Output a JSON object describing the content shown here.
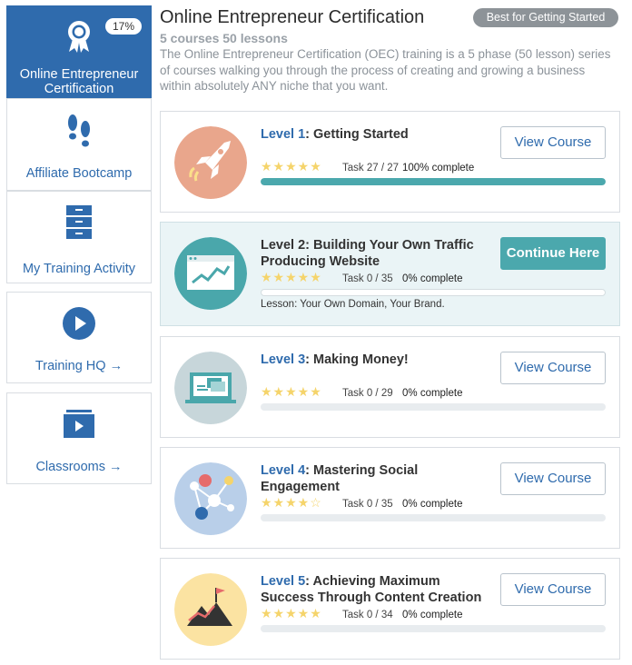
{
  "sidebar": {
    "items": [
      {
        "label": "Online Entrepreneur Certification",
        "badge": "17%",
        "icon": "award-ribbon-icon"
      },
      {
        "label": "Affiliate Bootcamp",
        "icon": "footprints-icon"
      },
      {
        "label": "My Training Activity",
        "icon": "file-cabinet-icon"
      },
      {
        "label": "Training HQ →",
        "icon": "play-circle-icon"
      },
      {
        "label": "Classrooms →",
        "icon": "video-folder-icon"
      }
    ]
  },
  "header": {
    "title": "Online Entrepreneur Certification",
    "subtitle": "5 courses 50 lessons",
    "description": "The Online Entrepreneur Certification (OEC) training is a 5 phase (50 lesson) series of courses walking you through the process of creating and growing a business within absolutely ANY niche that you want.",
    "badge": "Best for Getting Started"
  },
  "courses": [
    {
      "level": "Level 1",
      "title": ": Getting Started",
      "task": "Task 27 / 27",
      "complete": "100% complete",
      "progress": 1.0,
      "button": "View Course",
      "rating": "5 stars",
      "icon": "rocket-icon",
      "color": "#e9a68c"
    },
    {
      "level": "Level 2",
      "title": ": Building Your Own Traffic Producing Website",
      "task": "Task 0 / 35",
      "complete": "0% complete",
      "progress": 0,
      "button": "Continue Here",
      "rating": "5 stars",
      "lesson": "Lesson: Your Own Domain, Your Brand.",
      "icon": "website-chart-icon",
      "color": "#4aa7ab"
    },
    {
      "level": "Level 3",
      "title": ": Making Money!",
      "task": "Task 0 / 29",
      "complete": "0% complete",
      "progress": 0,
      "button": "View Course",
      "rating": "5 stars",
      "icon": "laptop-card-icon",
      "color": "#c7d6da"
    },
    {
      "level": "Level 4",
      "title": ": Mastering Social Engagement",
      "task": "Task 0 / 35",
      "complete": "0% complete",
      "progress": 0,
      "button": "View Course",
      "rating": "4.5 stars",
      "icon": "social-network-icon",
      "color": "#b9cfe9"
    },
    {
      "level": "Level 5",
      "title": ": Achieving Maximum Success Through Content Creation",
      "task": "Task 0 / 34",
      "complete": "0% complete",
      "progress": 0,
      "button": "View Course",
      "rating": "5 stars",
      "icon": "mountain-flag-icon",
      "color": "#fbe3a2"
    }
  ],
  "colors": {
    "accent": "#2f6bad",
    "teal": "#4ba8ad",
    "star": "#f5d46b"
  }
}
